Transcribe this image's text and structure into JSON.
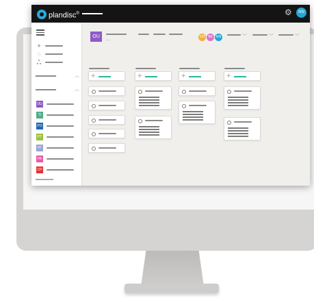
{
  "app": {
    "logo_text": "plandisc",
    "trademark": "®",
    "user_initials": "NN",
    "accent_color": "#29a9dc",
    "add_color": "#2ab59a"
  },
  "icons": {
    "settings": "gear-icon",
    "menu": "hamburger-icon",
    "add": "plus-icon",
    "search": "circle-icon",
    "people": "people-icon",
    "dropdown": "chevron-down-icon"
  },
  "sidebar": {
    "wheels": [
      {
        "code": "OU",
        "color": "#8d5bc7"
      },
      {
        "code": "TI",
        "color": "#4fae8a"
      },
      {
        "code": "PO",
        "color": "#1f67b1"
      },
      {
        "code": "PT",
        "color": "#9ac23c"
      },
      {
        "code": "HT",
        "color": "#9aa3d6"
      },
      {
        "code": "PA",
        "color": "#e85aa6"
      },
      {
        "code": "CP",
        "color": "#e8312f"
      }
    ]
  },
  "header": {
    "wheel_code": "OU",
    "wheel_color": "#8d5bc7",
    "subtitle": "...",
    "members": [
      {
        "initials": "ОЛ",
        "color": "#f2b13a"
      },
      {
        "initials": "ВК",
        "color": "#d874c8"
      },
      {
        "initials": "NN",
        "color": "#22a8d4"
      }
    ]
  }
}
